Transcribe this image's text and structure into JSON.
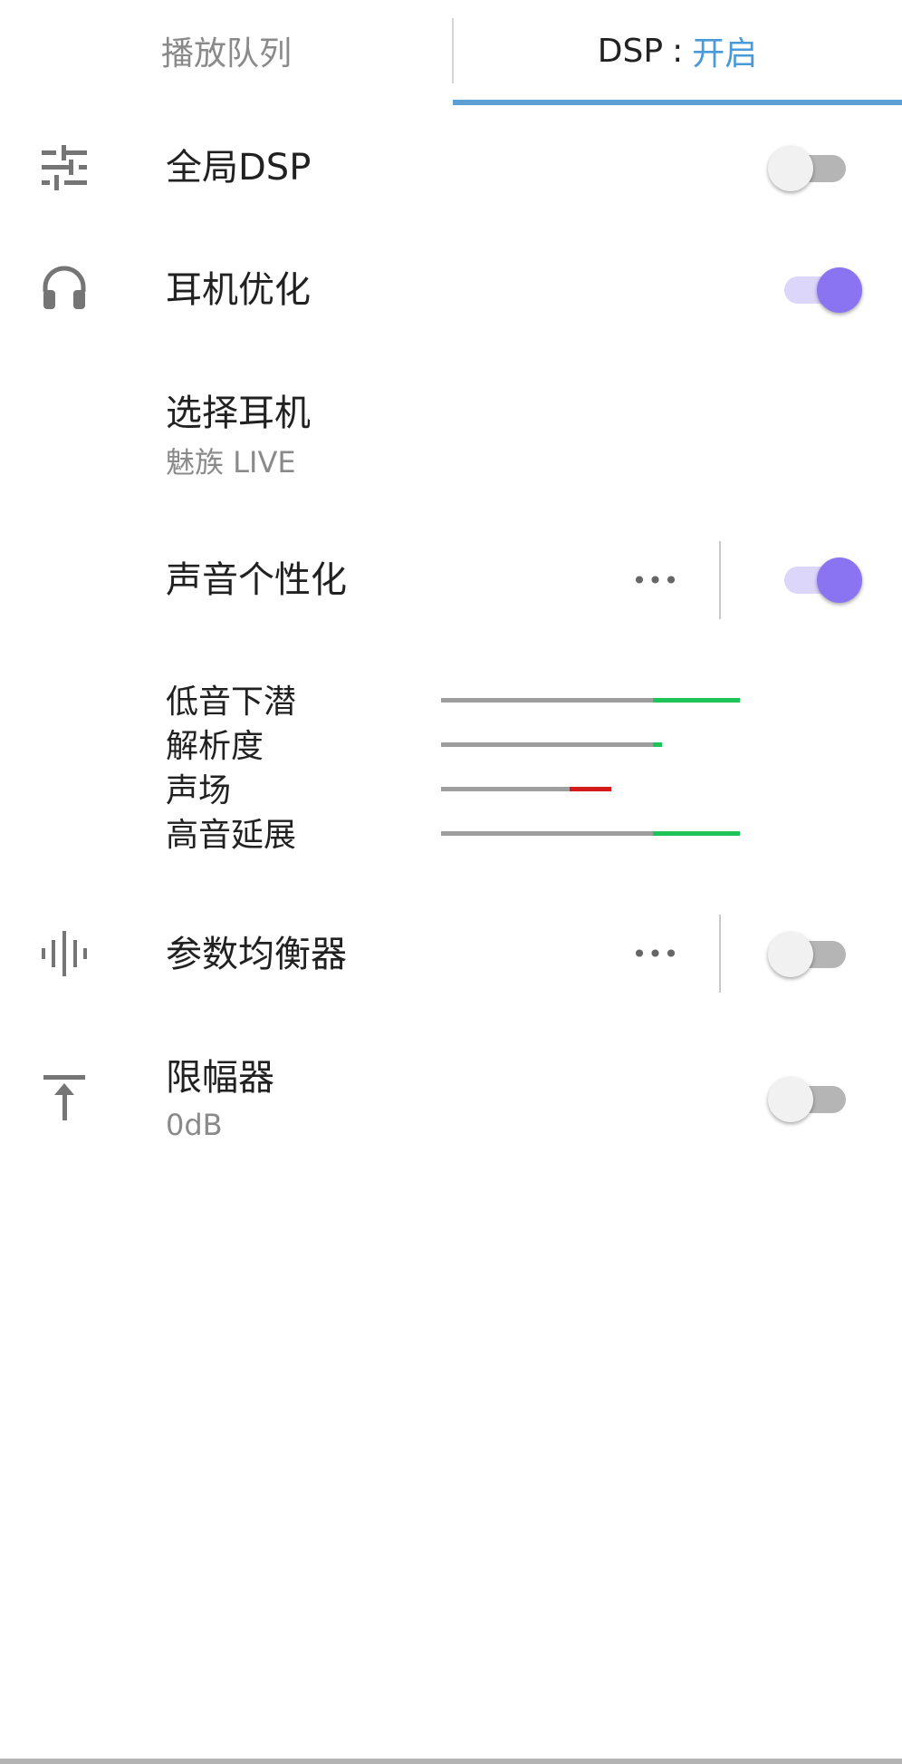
{
  "tabs": {
    "queue_label": "播放队列",
    "dsp_label": "DSP",
    "dsp_separator": ":",
    "dsp_state": "开启"
  },
  "rows": {
    "global_dsp": {
      "title": "全局DSP",
      "icon": "sliders-icon",
      "enabled": false
    },
    "headphone_opt": {
      "title": "耳机优化",
      "icon": "headphones-icon",
      "enabled": true
    },
    "select_headphone": {
      "title": "选择耳机",
      "value": "魅族 LIVE"
    },
    "sound_personal": {
      "title": "声音个性化",
      "enabled": true,
      "more": "•••"
    },
    "param_eq": {
      "title": "参数均衡器",
      "icon": "waveform-icon",
      "enabled": false,
      "more": "•••"
    },
    "limiter": {
      "title": "限幅器",
      "value": "0dB",
      "icon": "limit-top-icon",
      "enabled": false
    }
  },
  "metrics": [
    {
      "label": "低音下潜",
      "base": 0.71,
      "delta": 0.29,
      "color": "#1ec45a"
    },
    {
      "label": "解析度",
      "base": 0.71,
      "delta": 0.03,
      "color": "#1ec45a"
    },
    {
      "label": "声场",
      "base": 0.57,
      "delta": 0.14,
      "color": "#d41a1a"
    },
    {
      "label": "高音延展",
      "base": 0.71,
      "delta": 0.29,
      "color": "#1ec45a"
    }
  ],
  "colors": {
    "accent_tab": "#5b9fd3",
    "switch_on": "#8b74f2",
    "switch_on_track": "#ddd6fb",
    "positive": "#1ec45a",
    "negative": "#d41a1a"
  }
}
